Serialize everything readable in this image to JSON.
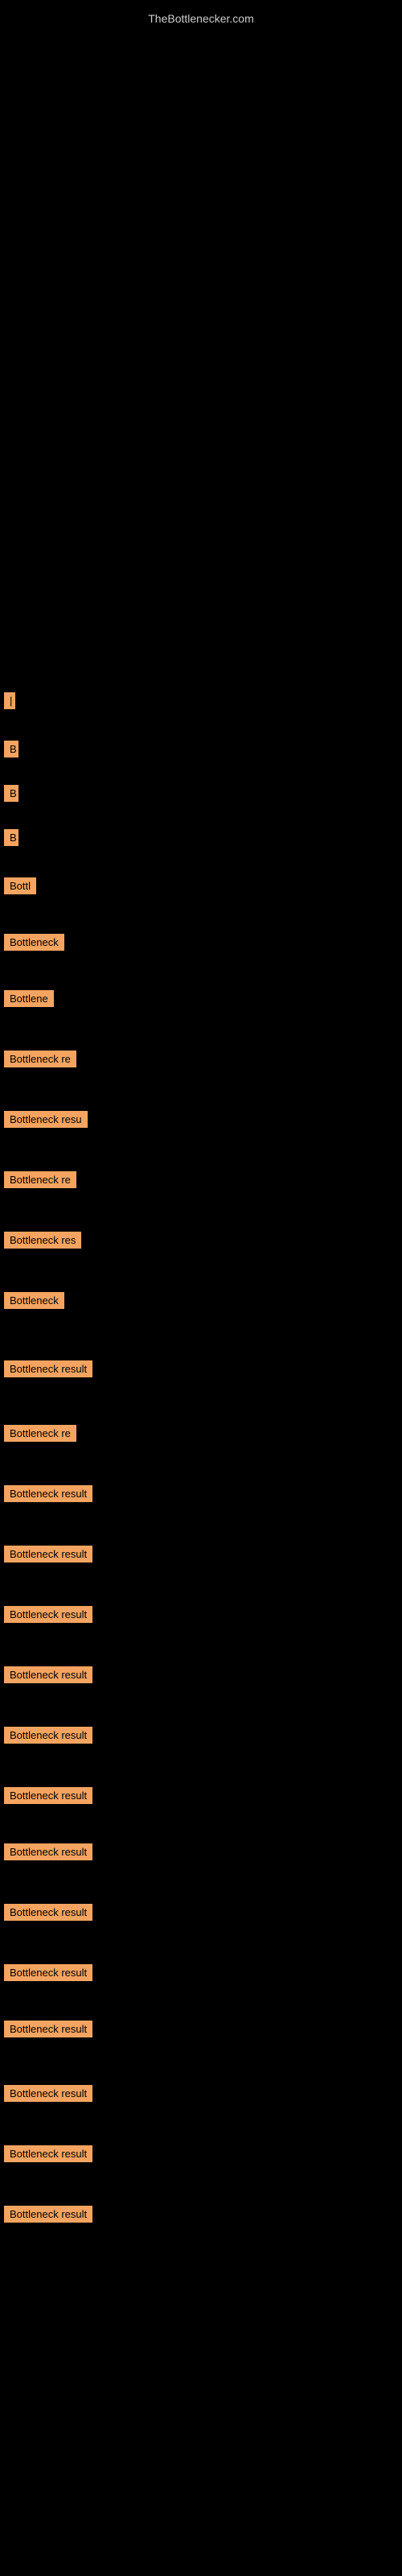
{
  "site": {
    "title": "TheBottlenecker.com"
  },
  "items": [
    {
      "id": 1,
      "label": "|",
      "width": 10
    },
    {
      "id": 2,
      "label": "B",
      "width": 18
    },
    {
      "id": 3,
      "label": "B",
      "width": 18
    },
    {
      "id": 4,
      "label": "B",
      "width": 18
    },
    {
      "id": 5,
      "label": "Bottl",
      "width": 45
    },
    {
      "id": 6,
      "label": "Bottleneck",
      "width": 85
    },
    {
      "id": 7,
      "label": "Bottlene",
      "width": 68
    },
    {
      "id": 8,
      "label": "Bottleneck re",
      "width": 108
    },
    {
      "id": 9,
      "label": "Bottleneck resu",
      "width": 125
    },
    {
      "id": 10,
      "label": "Bottleneck re",
      "width": 108
    },
    {
      "id": 11,
      "label": "Bottleneck res",
      "width": 115
    },
    {
      "id": 12,
      "label": "Bottleneck",
      "width": 85
    },
    {
      "id": 13,
      "label": "Bottleneck result",
      "width": 140
    },
    {
      "id": 14,
      "label": "Bottleneck re",
      "width": 108
    },
    {
      "id": 15,
      "label": "Bottleneck result",
      "width": 140
    },
    {
      "id": 16,
      "label": "Bottleneck result",
      "width": 140
    },
    {
      "id": 17,
      "label": "Bottleneck result",
      "width": 140
    },
    {
      "id": 18,
      "label": "Bottleneck result",
      "width": 140
    },
    {
      "id": 19,
      "label": "Bottleneck result",
      "width": 140
    },
    {
      "id": 20,
      "label": "Bottleneck result",
      "width": 140
    },
    {
      "id": 21,
      "label": "Bottleneck result",
      "width": 140
    },
    {
      "id": 22,
      "label": "Bottleneck result",
      "width": 140
    },
    {
      "id": 23,
      "label": "Bottleneck result",
      "width": 140
    },
    {
      "id": 24,
      "label": "Bottleneck result",
      "width": 140
    },
    {
      "id": 25,
      "label": "Bottleneck result",
      "width": 140
    },
    {
      "id": 26,
      "label": "Bottleneck result",
      "width": 140
    },
    {
      "id": 27,
      "label": "Bottleneck result",
      "width": 140
    }
  ]
}
